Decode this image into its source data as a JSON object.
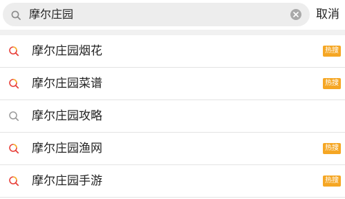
{
  "search": {
    "query": "摩尔庄园",
    "cancel_label": "取消"
  },
  "suggestions": [
    {
      "label": "摩尔庄园烟花",
      "icon": "hot-search-icon",
      "badge": "热搜"
    },
    {
      "label": "摩尔庄园菜谱",
      "icon": "hot-search-icon",
      "badge": "热搜"
    },
    {
      "label": "摩尔庄园攻略",
      "icon": "search-icon",
      "badge": ""
    },
    {
      "label": "摩尔庄园渔网",
      "icon": "hot-search-icon",
      "badge": "热搜"
    },
    {
      "label": "摩尔庄园手游",
      "icon": "hot-search-icon",
      "badge": "热搜"
    }
  ],
  "colors": {
    "badge": "#f5a623",
    "hot_icon_red": "#e8413b",
    "hot_icon_yellow": "#f7b52c",
    "search_box": "#ededed"
  }
}
